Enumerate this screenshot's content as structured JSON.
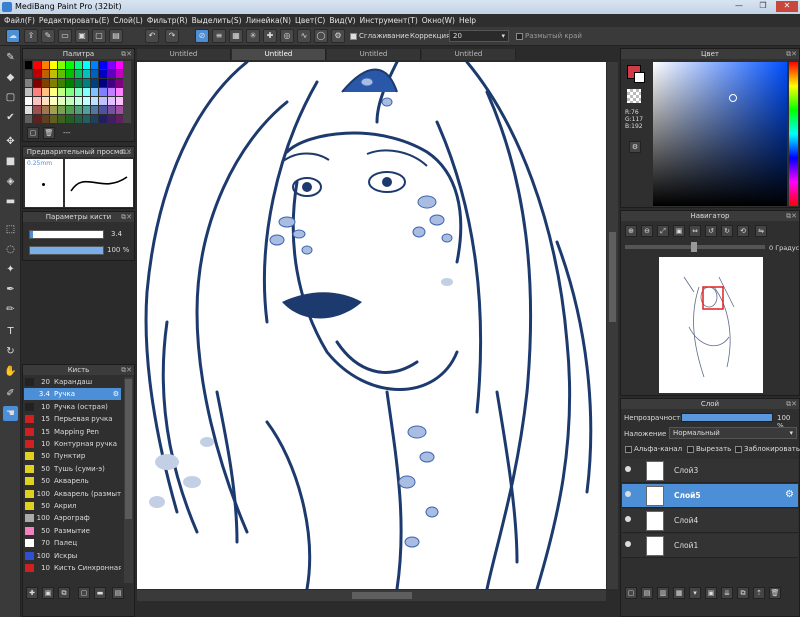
{
  "window": {
    "title": "MediBang Paint Pro (32bit)",
    "controls": [
      "—",
      "❐",
      "✕"
    ]
  },
  "menu": [
    "Файл(F)",
    "Редактировать(E)",
    "Слой(L)",
    "Фильтр(R)",
    "Выделить(S)",
    "Линейка(N)",
    "Цвет(C)",
    "Вид(V)",
    "Инструмент(T)",
    "Окно(W)",
    "Help"
  ],
  "toolbar": {
    "antialias_label": "Сглаживание",
    "correction_label": "Коррекция",
    "correction_value": "20",
    "blur_edge_label": "Размытый край"
  },
  "tabs": [
    "Untitled",
    "Untitled",
    "Untitled",
    "Untitled"
  ],
  "palette": {
    "title": "Палитра",
    "footer": "---",
    "colors": [
      "#000000",
      "#ff0000",
      "#ff8000",
      "#ffff00",
      "#80ff00",
      "#00ff00",
      "#00ff80",
      "#00ffff",
      "#0080ff",
      "#0000ff",
      "#8000ff",
      "#ff00ff",
      "#404040",
      "#c00000",
      "#c06000",
      "#c0c000",
      "#60c000",
      "#00c000",
      "#00c060",
      "#00c0c0",
      "#0060c0",
      "#0000c0",
      "#6000c0",
      "#c000c0",
      "#808080",
      "#800000",
      "#804000",
      "#808000",
      "#408000",
      "#008000",
      "#008040",
      "#008080",
      "#004080",
      "#000080",
      "#400080",
      "#800080",
      "#c0c0c0",
      "#ff8080",
      "#ffc080",
      "#ffff80",
      "#c0ff80",
      "#80ff80",
      "#80ffc0",
      "#80ffff",
      "#80c0ff",
      "#8080ff",
      "#c080ff",
      "#ff80ff",
      "#ffffff",
      "#ffc0c0",
      "#ffe0c0",
      "#ffffc0",
      "#e0ffc0",
      "#c0ffc0",
      "#c0ffe0",
      "#c0ffff",
      "#c0e0ff",
      "#c0c0ff",
      "#e0c0ff",
      "#ffc0ff",
      "#e0e0e0",
      "#a05050",
      "#a07850",
      "#a0a050",
      "#78a050",
      "#50a050",
      "#50a078",
      "#50a0a0",
      "#5078a0",
      "#5050a0",
      "#7850a0",
      "#a050a0",
      "#606060",
      "#602020",
      "#604020",
      "#606020",
      "#406020",
      "#206020",
      "#206040",
      "#206060",
      "#204060",
      "#202060",
      "#402060",
      "#602060"
    ]
  },
  "preview": {
    "title": "Предварительный просмо...",
    "size": "0.25mm"
  },
  "brush_params": {
    "title": "Параметры кисти",
    "size": "3.4",
    "opacity": "100 %"
  },
  "brush_panel": {
    "title": "Кисть",
    "items": [
      {
        "size": "20",
        "name": "Карандаш",
        "color": "#222222"
      },
      {
        "size": "3.4",
        "name": "Ручка",
        "color": "#4d8fd6"
      },
      {
        "size": "10",
        "name": "Ручка (острая)",
        "color": "#222222"
      },
      {
        "size": "15",
        "name": "Перьевая ручка",
        "color": "#d02020"
      },
      {
        "size": "15",
        "name": "Mapping Pen",
        "color": "#d02020"
      },
      {
        "size": "10",
        "name": "Контурная ручка",
        "color": "#d02020"
      },
      {
        "size": "50",
        "name": "Пунктир",
        "color": "#e0d020"
      },
      {
        "size": "50",
        "name": "Тушь (суми-э)",
        "color": "#e0d020"
      },
      {
        "size": "50",
        "name": "Акварель",
        "color": "#e0d020"
      },
      {
        "size": "100",
        "name": "Акварель (размыт",
        "color": "#e0d020"
      },
      {
        "size": "50",
        "name": "Акрил",
        "color": "#e0d020"
      },
      {
        "size": "100",
        "name": "Аэрограф",
        "color": "#aaaaaa"
      },
      {
        "size": "50",
        "name": "Размытие",
        "color": "#f080c0"
      },
      {
        "size": "70",
        "name": "Палец",
        "color": "#ffffff"
      },
      {
        "size": "100",
        "name": "Искры",
        "color": "#3050d0"
      },
      {
        "size": "10",
        "name": "Кисть Синхронная",
        "color": "#d02020"
      }
    ]
  },
  "color_panel": {
    "title": "Цвет",
    "r": "R:76",
    "g": "G:117",
    "b": "B:192",
    "main_color": "#4c75c0"
  },
  "navigator": {
    "title": "Навигатор",
    "angle": "0 Градус"
  },
  "layer_panel": {
    "title": "Слой",
    "opacity_label": "Непрозрачность",
    "opacity_value": "100 %",
    "opacity": 1.0,
    "blend_label": "Наложение",
    "blend_value": "Нормальный",
    "alpha_label": "Альфа-канал",
    "clip_label": "Вырезать",
    "lock_label": "Заблокировать",
    "layers": [
      "Слой3",
      "Слой5",
      "Слой4",
      "Слой1"
    ]
  }
}
